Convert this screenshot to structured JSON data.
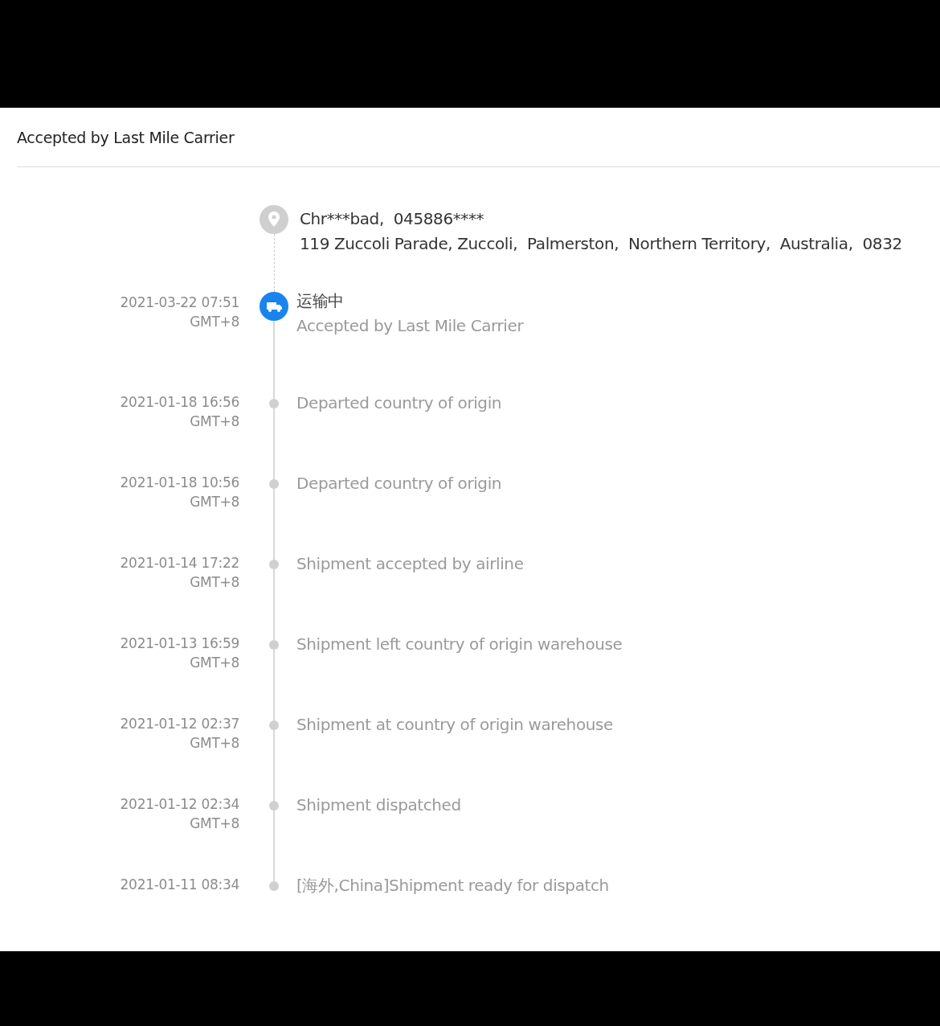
{
  "header": {
    "title": "Accepted by Last Mile Carrier"
  },
  "address": {
    "recipient": "Chr***bad,  045886****",
    "line": "119 Zuccoli Parade, Zuccoli,  Palmerston,  Northern Territory,  Australia,  0832"
  },
  "events": [
    {
      "kind": "current",
      "time": "2021-03-22 07:51",
      "timezone": "GMT+8",
      "status": "运输中",
      "description": "Accepted by Last Mile Carrier"
    },
    {
      "kind": "past",
      "time": "2021-01-18 16:56",
      "timezone": "GMT+8",
      "description": "Departed country of origin"
    },
    {
      "kind": "past",
      "time": "2021-01-18 10:56",
      "timezone": "GMT+8",
      "description": "Departed country of origin"
    },
    {
      "kind": "past",
      "time": "2021-01-14 17:22",
      "timezone": "GMT+8",
      "description": "Shipment accepted by airline"
    },
    {
      "kind": "past",
      "time": "2021-01-13 16:59",
      "timezone": "GMT+8",
      "description": "Shipment left country of origin warehouse"
    },
    {
      "kind": "past",
      "time": "2021-01-12 02:37",
      "timezone": "GMT+8",
      "description": "Shipment at country of origin warehouse"
    },
    {
      "kind": "past",
      "time": "2021-01-12 02:34",
      "timezone": "GMT+8",
      "description": "Shipment dispatched"
    },
    {
      "kind": "past",
      "time": "2021-01-11 08:34",
      "description": "[海外,China]Shipment ready for dispatch"
    }
  ]
}
